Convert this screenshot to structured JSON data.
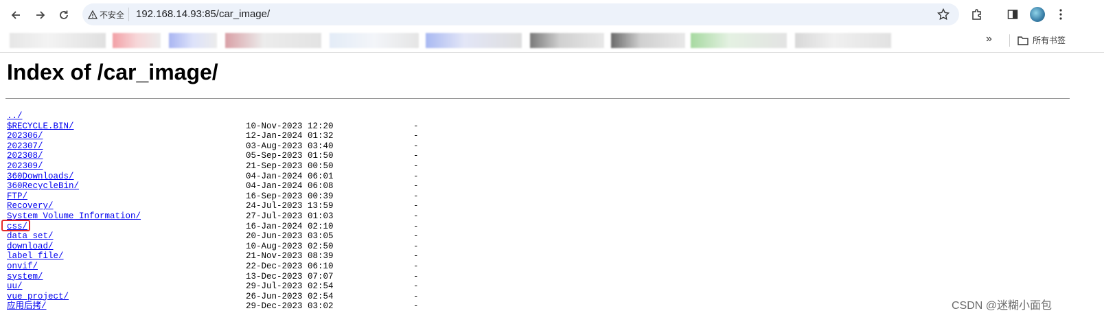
{
  "browser": {
    "security_label": "不安全",
    "url": "192.168.14.93:85/car_image/",
    "all_bookmarks_label": "所有书签",
    "more_bookmarks": "»"
  },
  "page": {
    "title": "Index of /car_image/",
    "entries": [
      {
        "name": "../",
        "date": "",
        "size": ""
      },
      {
        "name": "$RECYCLE.BIN/",
        "date": "10-Nov-2023 12:20",
        "size": "-"
      },
      {
        "name": "202306/",
        "date": "12-Jan-2024 01:32",
        "size": "-"
      },
      {
        "name": "202307/",
        "date": "03-Aug-2023 03:40",
        "size": "-"
      },
      {
        "name": "202308/",
        "date": "05-Sep-2023 01:50",
        "size": "-"
      },
      {
        "name": "202309/",
        "date": "21-Sep-2023 00:50",
        "size": "-"
      },
      {
        "name": "360Downloads/",
        "date": "04-Jan-2024 06:01",
        "size": "-"
      },
      {
        "name": "360RecycleBin/",
        "date": "04-Jan-2024 06:08",
        "size": "-"
      },
      {
        "name": "FTP/",
        "date": "16-Sep-2023 00:39",
        "size": "-"
      },
      {
        "name": "Recovery/",
        "date": "24-Jul-2023 13:59",
        "size": "-"
      },
      {
        "name": "System Volume Information/",
        "date": "27-Jul-2023 01:03",
        "size": "-"
      },
      {
        "name": "css/",
        "date": "16-Jan-2024 02:10",
        "size": "-"
      },
      {
        "name": "data_set/",
        "date": "20-Jun-2023 03:05",
        "size": "-"
      },
      {
        "name": "download/",
        "date": "10-Aug-2023 02:50",
        "size": "-"
      },
      {
        "name": "label_file/",
        "date": "21-Nov-2023 08:39",
        "size": "-"
      },
      {
        "name": "onvif/",
        "date": "22-Dec-2023 06:10",
        "size": "-"
      },
      {
        "name": "system/",
        "date": "13-Dec-2023 07:07",
        "size": "-"
      },
      {
        "name": "uu/",
        "date": "29-Jul-2023 02:54",
        "size": "-"
      },
      {
        "name": "vue_project/",
        "date": "26-Jun-2023 02:54",
        "size": "-"
      },
      {
        "name": "应用后拷/",
        "date": "29-Dec-2023 03:02",
        "size": "-"
      }
    ]
  },
  "watermark": "CSDN @迷糊小面包",
  "colors": {
    "link": "#0000ee",
    "highlight": "#e52828",
    "omnibox": "#edf2fa"
  }
}
